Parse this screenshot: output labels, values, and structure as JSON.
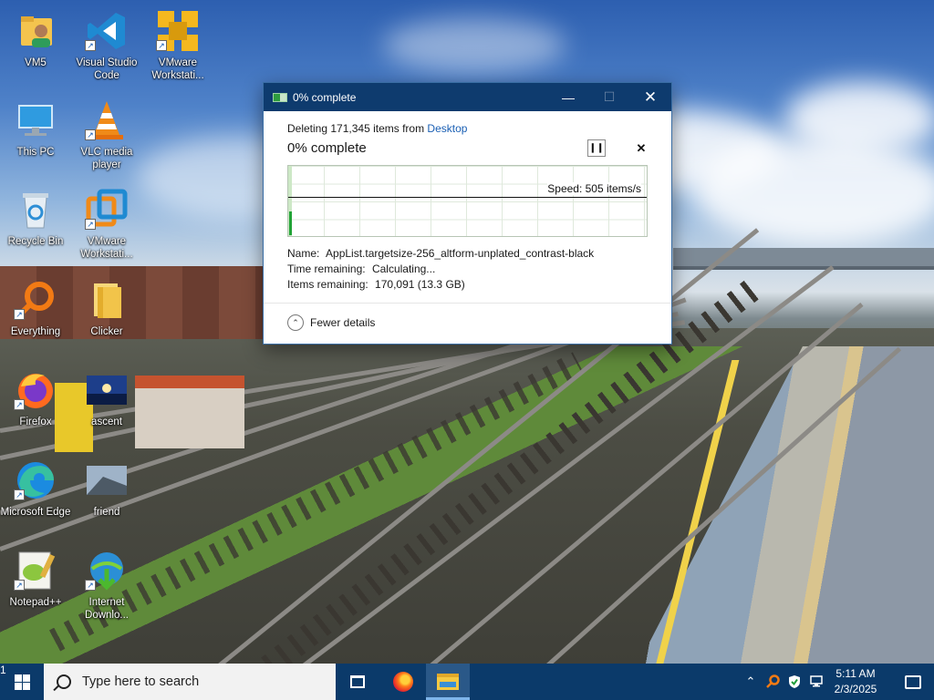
{
  "desktop": {
    "icons": [
      {
        "label": "VM5",
        "icon": "user-folder-icon"
      },
      {
        "label": "Visual Studio Code",
        "icon": "vscode-icon"
      },
      {
        "label": "VMware Workstati...",
        "icon": "vmware-workstation-icon"
      },
      {
        "label": "This PC",
        "icon": "computer-icon"
      },
      {
        "label": "VLC media player",
        "icon": "vlc-cone-icon"
      },
      {
        "label": "Recycle Bin",
        "icon": "recycle-bin-icon"
      },
      {
        "label": "VMware Workstati...",
        "icon": "vmware-workstation-icon"
      },
      {
        "label": "Everything",
        "icon": "everything-search-icon"
      },
      {
        "label": "Clicker",
        "icon": "folder-icon"
      },
      {
        "label": "Firefox",
        "icon": "firefox-icon"
      },
      {
        "label": "ascent",
        "icon": "image-file-icon"
      },
      {
        "label": "Microsoft Edge",
        "icon": "edge-icon"
      },
      {
        "label": "friend",
        "icon": "image-file-icon"
      },
      {
        "label": "Notepad++",
        "icon": "notepad-plus-plus-icon"
      },
      {
        "label": "Internet Downlo...",
        "icon": "internet-download-manager-icon"
      }
    ]
  },
  "dialog": {
    "title": "0% complete",
    "deleting_prefix": "Deleting 171,345 items from",
    "deleting_location": "Desktop",
    "percent_text": "0% complete",
    "progress_percent": 0,
    "speed": "Speed: 505 items/s",
    "name_label": "Name:",
    "name_value": "AppList.targetsize-256_altform-unplated_contrast-black",
    "time_label": "Time remaining:",
    "time_value": "Calculating...",
    "items_label": "Items remaining:",
    "items_value": "170,091 (13.3 GB)",
    "fewer_details": "Fewer details"
  },
  "taskbar": {
    "search_placeholder": "Type here to search",
    "time": "5:11 AM",
    "date": "2/3/2025",
    "notification_count": "1"
  }
}
